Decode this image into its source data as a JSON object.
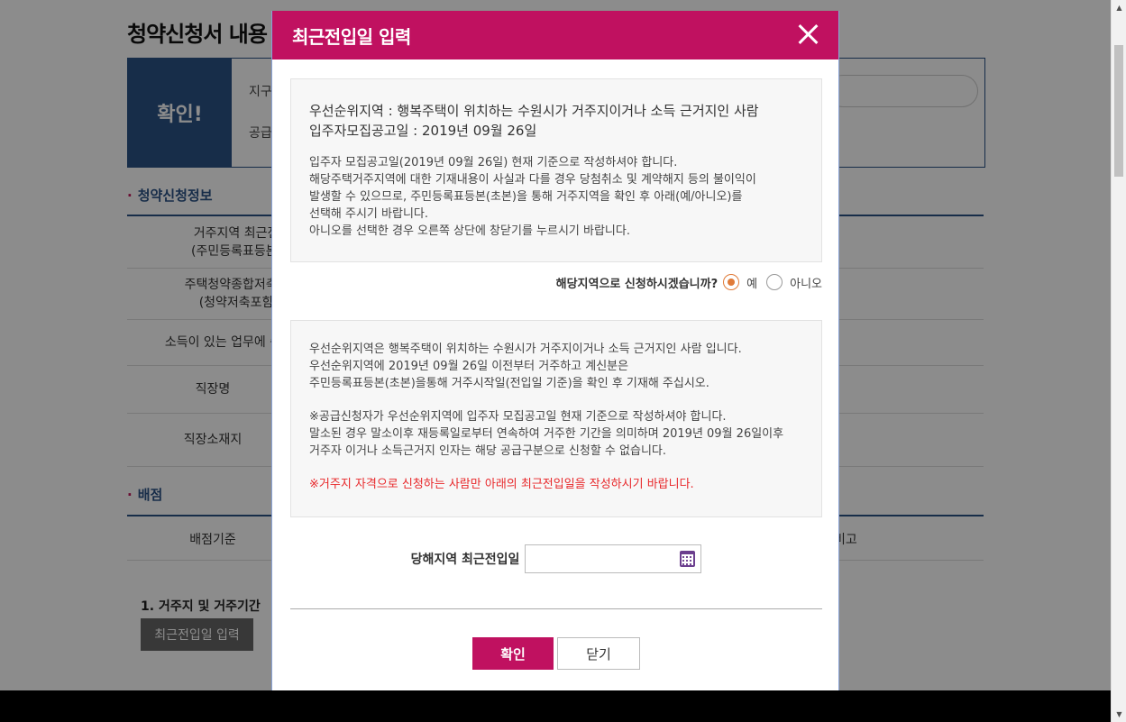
{
  "background": {
    "page_title": "청약신청서 내용",
    "confirm_badge": "확인!",
    "confirm_line1": "지구",
    "confirm_line2": "공급",
    "section1_title": "청약신청정보",
    "rows": [
      {
        "label": "거주지역 최근전입\n(주민등록표등본 기"
      },
      {
        "label": "주택청약종합저축 가\n(청약저축포함)"
      },
      {
        "label": "소득이 있는 업무에 종사"
      },
      {
        "label": "직장명"
      },
      {
        "label": "직장소재지"
      }
    ],
    "section2_title": "배점",
    "score_header_left": "배점기준",
    "score_header_right": "비고",
    "item1": "1. 거주지 및 거주기간",
    "item1_button": "최근전입일 입력"
  },
  "modal": {
    "title": "최근전입일 입력",
    "info1_line1": "우선순위지역 : 행복주택이 위치하는 수원시가 거주지이거나 소득 근거지인 사람",
    "info1_line2": "입주자모집공고일 : 2019년 09월 26일",
    "info1_small": [
      "입주자 모집공고일(2019년 09월 26일) 현재 기준으로 작성하셔야 합니다.",
      "해당주택거주지역에 대한 기재내용이 사실과 다를 경우 당첨취소 및 계약해지 등의 불이익이",
      "발생할 수 있으므로, 주민등록표등본(초본)을 통해 거주지역을 확인 후 아래(예/아니오)를",
      "선택해 주시기 바랍니다.",
      "아니오를 선택한 경우 오른쪽 상단에 창닫기를 누르시기 바랍니다."
    ],
    "question": "해당지역으로 신청하시겠습니까?",
    "option_yes": "예",
    "option_no": "아니오",
    "selected": "예",
    "info2_p1": [
      "우선순위지역은 행복주택이 위치하는 수원시가 거주지이거나 소득 근거지인 사람 입니다.",
      "우선순위지역에 2019년 09월 26일 이전부터 거주하고 계신분은",
      "주민등록표등본(초본)을통해 거주시작일(전입일 기준)을 확인 후 기재해 주십시오."
    ],
    "info2_p2": [
      "※공급신청자가 우선순위지역에 입주자 모집공고일 현재 기준으로 작성하셔야 합니다.",
      "말소된 경우 말소이후 재등록일로부터 연속하여 거주한 기간을 의미하며 2019년 09월 26일이후",
      "거주자 이거나 소득근거지 인자는 해당 공급구분으로 신청할 수 없습니다."
    ],
    "info2_warn": "※거주지 자격으로 신청하는 사람만 아래의 최근전입일을 작성하시기 바랍니다.",
    "date_label": "당해지역 최근전입일",
    "date_value": "",
    "ok_button": "확인",
    "close_button": "닫기",
    "accent_color": "#c01160"
  }
}
